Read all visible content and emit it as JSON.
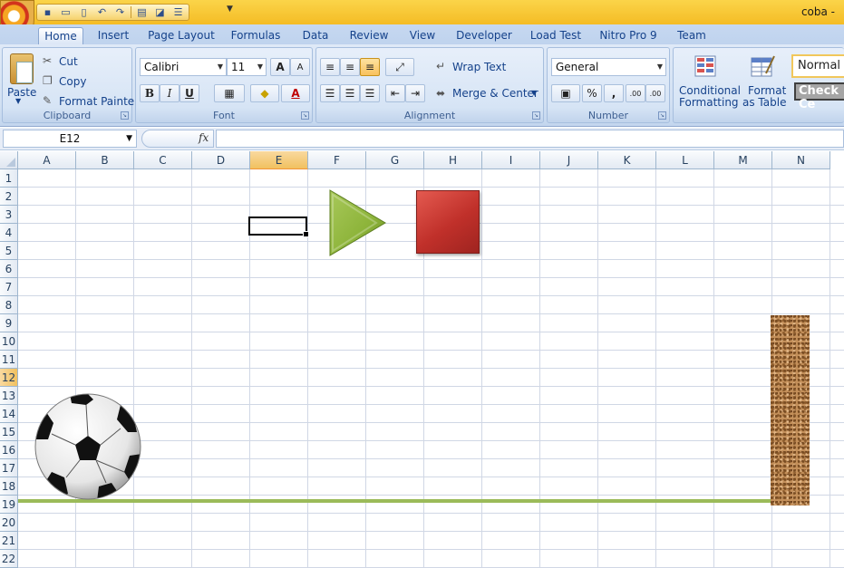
{
  "window": {
    "title": "coba -"
  },
  "quick_access": {
    "icons": [
      "save-icon",
      "open-folder-icon",
      "new-document-icon",
      "undo-icon",
      "redo-icon",
      "print-icon",
      "print-preview-icon",
      "format-icon"
    ]
  },
  "tabs": [
    {
      "label": "Home",
      "active": true
    },
    {
      "label": "Insert"
    },
    {
      "label": "Page Layout"
    },
    {
      "label": "Formulas"
    },
    {
      "label": "Data"
    },
    {
      "label": "Review"
    },
    {
      "label": "View"
    },
    {
      "label": "Developer"
    },
    {
      "label": "Load Test"
    },
    {
      "label": "Nitro Pro 9"
    },
    {
      "label": "Team"
    }
  ],
  "ribbon": {
    "clipboard": {
      "label": "Clipboard",
      "paste": "Paste",
      "cut": "Cut",
      "copy": "Copy",
      "format_painter": "Format Painter"
    },
    "font": {
      "label": "Font",
      "name": "Calibri",
      "size": "11",
      "bold": "B",
      "italic": "I",
      "underline": "U",
      "grow": "A",
      "shrink": "A",
      "font_color_glyph": "A"
    },
    "alignment": {
      "label": "Alignment",
      "wrap_text": "Wrap Text",
      "merge_center": "Merge & Center"
    },
    "number": {
      "label": "Number",
      "format": "General",
      "percent": "%",
      "comma": ",",
      "inc_decimal": ".00",
      "dec_decimal": ".00"
    },
    "styles": {
      "conditional_formatting": [
        "Conditional",
        "Formatting"
      ],
      "format_as_table": [
        "Format",
        "as Table"
      ],
      "style_normal": "Normal",
      "style_check": "Check Ce"
    }
  },
  "formula_bar": {
    "name_box": "E12",
    "fx": "fx",
    "formula": ""
  },
  "sheet": {
    "columns": [
      "A",
      "B",
      "C",
      "D",
      "E",
      "F",
      "G",
      "H",
      "I",
      "J",
      "K",
      "L",
      "M",
      "N"
    ],
    "rows": [
      "1",
      "2",
      "3",
      "4",
      "5",
      "6",
      "7",
      "8",
      "9",
      "10",
      "11",
      "12",
      "13",
      "14",
      "15",
      "16",
      "17",
      "18",
      "19",
      "20",
      "21",
      "22"
    ],
    "selected_column": "E",
    "selected_row": "12"
  },
  "colors": {
    "play": "#8db43a",
    "stop": "#c0302a",
    "ground": "#9bbb59",
    "cork": "#c4905a"
  }
}
